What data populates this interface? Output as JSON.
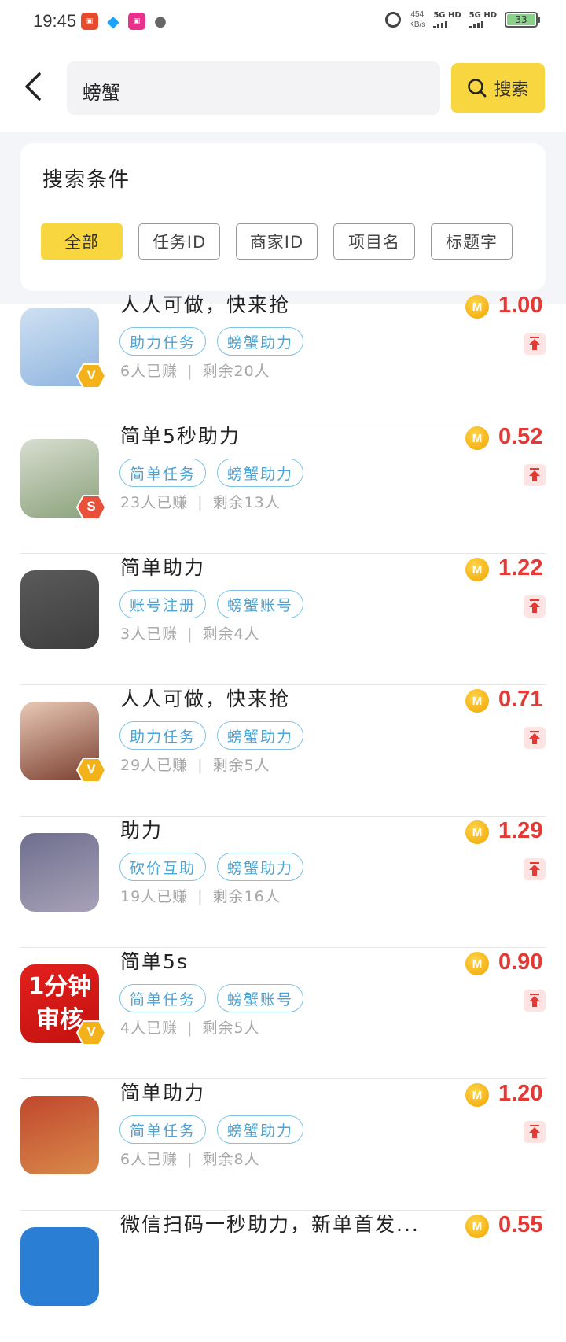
{
  "status_bar": {
    "time": "19:45",
    "speed_value": "454",
    "speed_unit": "KB/s",
    "sig1": "5G HD",
    "sig2": "5G HD",
    "battery": "33"
  },
  "header": {
    "search_value": "螃蟹",
    "search_button": "搜索"
  },
  "filter": {
    "title": "搜索条件",
    "chips": [
      "全部",
      "任务ID",
      "商家ID",
      "项目名",
      "标题字"
    ],
    "active_index": 0
  },
  "tasks": [
    {
      "title": "人人可做，快来抢",
      "tags": [
        "助力任务",
        "螃蟹助力"
      ],
      "earned": "6人已赚",
      "remaining": "剩余20人",
      "price": "1.00",
      "badge": "V",
      "avatar_colors": [
        "#cfe0f2",
        "#8fb5df"
      ]
    },
    {
      "title": "简单5秒助力",
      "tags": [
        "简单任务",
        "螃蟹助力"
      ],
      "earned": "23人已赚",
      "remaining": "剩余13人",
      "price": "0.52",
      "badge": "S",
      "avatar_colors": [
        "#d8ddd0",
        "#8aa27a"
      ]
    },
    {
      "title": "简单助力",
      "tags": [
        "账号注册",
        "螃蟹账号"
      ],
      "earned": "3人已赚",
      "remaining": "剩余4人",
      "price": "1.22",
      "badge": "",
      "avatar_colors": [
        "#5a5a5a",
        "#3e3e3e"
      ]
    },
    {
      "title": "人人可做，快来抢",
      "tags": [
        "助力任务",
        "螃蟹助力"
      ],
      "earned": "29人已赚",
      "remaining": "剩余5人",
      "price": "0.71",
      "badge": "V",
      "avatar_colors": [
        "#e9c9b7",
        "#7a3e2e"
      ]
    },
    {
      "title": "助力",
      "tags": [
        "砍价互助",
        "螃蟹助力"
      ],
      "earned": "19人已赚",
      "remaining": "剩余16人",
      "price": "1.29",
      "badge": "",
      "avatar_colors": [
        "#6e6e8e",
        "#a8a2b8"
      ]
    },
    {
      "title": "简单5s",
      "tags": [
        "简单任务",
        "螃蟹账号"
      ],
      "earned": "4人已赚",
      "remaining": "剩余5人",
      "price": "0.90",
      "badge": "V",
      "avatar_colors": [
        "#e2201d",
        "#c3120f"
      ],
      "avatar_text": [
        "1分钟",
        "审核"
      ]
    },
    {
      "title": "简单助力",
      "tags": [
        "简单任务",
        "螃蟹助力"
      ],
      "earned": "6人已赚",
      "remaining": "剩余8人",
      "price": "1.20",
      "badge": "",
      "avatar_colors": [
        "#c0472e",
        "#d98a4a"
      ]
    },
    {
      "title": "微信扫码一秒助力，新单首发...",
      "tags": [],
      "earned": "",
      "remaining": "",
      "price": "0.55",
      "badge": "",
      "avatar_colors": [
        "#2a7fd4",
        "#2a7fd4"
      ]
    }
  ],
  "colors": {
    "accent": "#f7d640",
    "price": "#e53935",
    "tag": "#4ba3d6"
  }
}
